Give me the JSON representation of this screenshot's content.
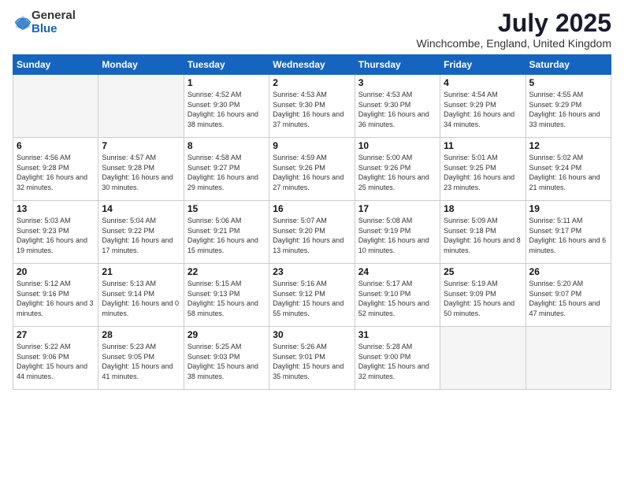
{
  "logo": {
    "general": "General",
    "blue": "Blue"
  },
  "title": {
    "month_year": "July 2025",
    "location": "Winchcombe, England, United Kingdom"
  },
  "days_of_week": [
    "Sunday",
    "Monday",
    "Tuesday",
    "Wednesday",
    "Thursday",
    "Friday",
    "Saturday"
  ],
  "weeks": [
    [
      {
        "day": "",
        "info": ""
      },
      {
        "day": "",
        "info": ""
      },
      {
        "day": "1",
        "info": "Sunrise: 4:52 AM\nSunset: 9:30 PM\nDaylight: 16 hours and 38 minutes."
      },
      {
        "day": "2",
        "info": "Sunrise: 4:53 AM\nSunset: 9:30 PM\nDaylight: 16 hours and 37 minutes."
      },
      {
        "day": "3",
        "info": "Sunrise: 4:53 AM\nSunset: 9:30 PM\nDaylight: 16 hours and 36 minutes."
      },
      {
        "day": "4",
        "info": "Sunrise: 4:54 AM\nSunset: 9:29 PM\nDaylight: 16 hours and 34 minutes."
      },
      {
        "day": "5",
        "info": "Sunrise: 4:55 AM\nSunset: 9:29 PM\nDaylight: 16 hours and 33 minutes."
      }
    ],
    [
      {
        "day": "6",
        "info": "Sunrise: 4:56 AM\nSunset: 9:28 PM\nDaylight: 16 hours and 32 minutes."
      },
      {
        "day": "7",
        "info": "Sunrise: 4:57 AM\nSunset: 9:28 PM\nDaylight: 16 hours and 30 minutes."
      },
      {
        "day": "8",
        "info": "Sunrise: 4:58 AM\nSunset: 9:27 PM\nDaylight: 16 hours and 29 minutes."
      },
      {
        "day": "9",
        "info": "Sunrise: 4:59 AM\nSunset: 9:26 PM\nDaylight: 16 hours and 27 minutes."
      },
      {
        "day": "10",
        "info": "Sunrise: 5:00 AM\nSunset: 9:26 PM\nDaylight: 16 hours and 25 minutes."
      },
      {
        "day": "11",
        "info": "Sunrise: 5:01 AM\nSunset: 9:25 PM\nDaylight: 16 hours and 23 minutes."
      },
      {
        "day": "12",
        "info": "Sunrise: 5:02 AM\nSunset: 9:24 PM\nDaylight: 16 hours and 21 minutes."
      }
    ],
    [
      {
        "day": "13",
        "info": "Sunrise: 5:03 AM\nSunset: 9:23 PM\nDaylight: 16 hours and 19 minutes."
      },
      {
        "day": "14",
        "info": "Sunrise: 5:04 AM\nSunset: 9:22 PM\nDaylight: 16 hours and 17 minutes."
      },
      {
        "day": "15",
        "info": "Sunrise: 5:06 AM\nSunset: 9:21 PM\nDaylight: 16 hours and 15 minutes."
      },
      {
        "day": "16",
        "info": "Sunrise: 5:07 AM\nSunset: 9:20 PM\nDaylight: 16 hours and 13 minutes."
      },
      {
        "day": "17",
        "info": "Sunrise: 5:08 AM\nSunset: 9:19 PM\nDaylight: 16 hours and 10 minutes."
      },
      {
        "day": "18",
        "info": "Sunrise: 5:09 AM\nSunset: 9:18 PM\nDaylight: 16 hours and 8 minutes."
      },
      {
        "day": "19",
        "info": "Sunrise: 5:11 AM\nSunset: 9:17 PM\nDaylight: 16 hours and 6 minutes."
      }
    ],
    [
      {
        "day": "20",
        "info": "Sunrise: 5:12 AM\nSunset: 9:16 PM\nDaylight: 16 hours and 3 minutes."
      },
      {
        "day": "21",
        "info": "Sunrise: 5:13 AM\nSunset: 9:14 PM\nDaylight: 16 hours and 0 minutes."
      },
      {
        "day": "22",
        "info": "Sunrise: 5:15 AM\nSunset: 9:13 PM\nDaylight: 15 hours and 58 minutes."
      },
      {
        "day": "23",
        "info": "Sunrise: 5:16 AM\nSunset: 9:12 PM\nDaylight: 15 hours and 55 minutes."
      },
      {
        "day": "24",
        "info": "Sunrise: 5:17 AM\nSunset: 9:10 PM\nDaylight: 15 hours and 52 minutes."
      },
      {
        "day": "25",
        "info": "Sunrise: 5:19 AM\nSunset: 9:09 PM\nDaylight: 15 hours and 50 minutes."
      },
      {
        "day": "26",
        "info": "Sunrise: 5:20 AM\nSunset: 9:07 PM\nDaylight: 15 hours and 47 minutes."
      }
    ],
    [
      {
        "day": "27",
        "info": "Sunrise: 5:22 AM\nSunset: 9:06 PM\nDaylight: 15 hours and 44 minutes."
      },
      {
        "day": "28",
        "info": "Sunrise: 5:23 AM\nSunset: 9:05 PM\nDaylight: 15 hours and 41 minutes."
      },
      {
        "day": "29",
        "info": "Sunrise: 5:25 AM\nSunset: 9:03 PM\nDaylight: 15 hours and 38 minutes."
      },
      {
        "day": "30",
        "info": "Sunrise: 5:26 AM\nSunset: 9:01 PM\nDaylight: 15 hours and 35 minutes."
      },
      {
        "day": "31",
        "info": "Sunrise: 5:28 AM\nSunset: 9:00 PM\nDaylight: 15 hours and 32 minutes."
      },
      {
        "day": "",
        "info": ""
      },
      {
        "day": "",
        "info": ""
      }
    ]
  ]
}
